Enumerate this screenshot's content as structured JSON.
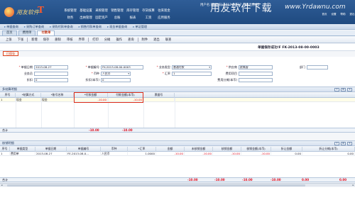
{
  "header": {
    "logo_text": "用友软件",
    "logo_t": "T",
    "nav_row1": [
      "系统管理",
      "基础设置",
      "采购管理",
      "销售管理",
      "库存管理",
      "存货核算",
      "往来现金"
    ],
    "nav_row2": [
      "财务",
      "出纳管理",
      "固定资产",
      "总账",
      "报表",
      "工资",
      "应用服务"
    ],
    "userinfo": "用户名:[管理员] 2013-08-27 【退出系统】",
    "watermark": "用友软件下载",
    "watermark_url": "www.Yrdawnu.com",
    "icons": [
      "首页",
      "设置",
      "帮助",
      "退出"
    ]
  },
  "breadcrumbs": [
    "单据查询",
    "采购订单查询",
    "采购付款单查询",
    "销售付款单查询",
    "现金单据查询",
    "单证管理"
  ],
  "tabs": [
    {
      "label": "首页",
      "active": false
    },
    {
      "label": "费用单",
      "active": false
    },
    {
      "label": "付款单",
      "active": true
    }
  ],
  "toolbar": [
    "上张",
    "下张",
    "新增",
    "保存",
    "删除",
    "审核",
    "弃审",
    "打印",
    "分摊",
    "操作",
    "查询",
    "附件",
    "退出",
    "联查"
  ],
  "status_label": "已保存",
  "save_message": "单据保存成功!F FK-2013-08-00-0003",
  "form": {
    "date_label": "单据日期",
    "date_value": "2013-08-27",
    "number_label": "单据编号",
    "number_value": "FK-2013-08-00-0003",
    "type_label": "业务类型",
    "type_value": "普通付款",
    "supplier_label": "供应商",
    "supplier_value": "欧美客",
    "dept_label": "部门",
    "dept_value": "",
    "salesman_label": "业务员",
    "salesman_value": "",
    "currency_label": "币种",
    "currency_value": "人民币",
    "rate_label": "汇率",
    "rate_value": "1",
    "fee_label": "费用项目",
    "fee_value": "",
    "discount_label": "折扣",
    "discount_value": "0",
    "discount_local_label": "折扣(本币)",
    "discount_local_value": "0",
    "fee_split_label": "费用分摊(本币)",
    "fee_split_value": ""
  },
  "payment_section": {
    "title": "多结算明细",
    "columns": [
      "序号",
      "*结算方式",
      "*账号名称",
      "*付款金额",
      "付款金额(本币)",
      "票据号"
    ],
    "rows": [
      {
        "no": "1",
        "method": "现金",
        "account": "现金",
        "amount": "-10.00",
        "amount_local": "-10.00",
        "ticket": ""
      }
    ],
    "total_label": "合计",
    "total_amount": "-10.00",
    "total_local": "-10.00"
  },
  "detail_section": {
    "title": "核销明细",
    "columns": [
      "序号",
      "单据类型",
      "单据日期",
      "单据编号",
      "币种",
      "*汇率",
      "金额",
      "未核销金额",
      "核销金额",
      "核销金额(本币)",
      "折让金额",
      "折让分摊(本币)"
    ],
    "rows": [
      {
        "no": "1",
        "type": "费用单",
        "date": "2013-08-27",
        "number": "FE-2013-08-0...",
        "currency": "人民币",
        "rate": "1.0000",
        "amount": "-10.00",
        "unwritten": "-10.00",
        "written": "-10.00",
        "written_local": "-10.00",
        "discount": "0.00",
        "discount_split": "0.00"
      }
    ],
    "total_label": "合计",
    "totals": [
      "-10.00",
      "-10.00",
      "-10.00",
      "-10.00",
      "0.00",
      "0.00"
    ]
  },
  "colors": {
    "header_bg": "#1f4a80",
    "accent_red": "#e0301a",
    "negative": "#dd1122"
  }
}
